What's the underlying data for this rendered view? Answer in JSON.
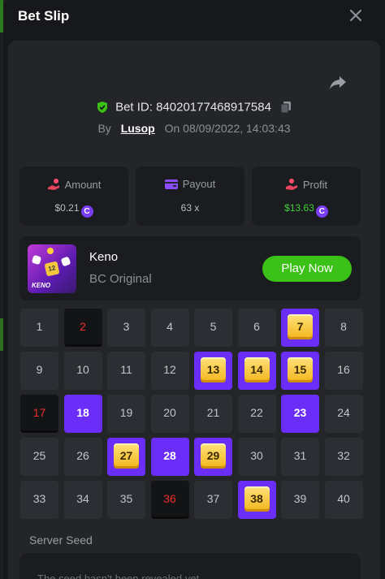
{
  "header": {
    "title": "Bet Slip"
  },
  "bet": {
    "id_label": "Bet ID: 84020177468917584",
    "by_label": "By",
    "user": "Lusop",
    "on_label": "On",
    "datetime": "08/09/2022, 14:03:43"
  },
  "stats": {
    "amount": {
      "label": "Amount",
      "value": "$0.21"
    },
    "payout": {
      "label": "Payout",
      "value": "63 x"
    },
    "profit": {
      "label": "Profit",
      "value": "$13.63"
    }
  },
  "coin_glyph": "C",
  "game": {
    "name": "Keno",
    "subtitle": "BC Original",
    "play_label": "Play Now",
    "thumb_die_1": "12",
    "thumb_text": "KENO"
  },
  "grid": {
    "cells": [
      {
        "n": "1",
        "s": "normal"
      },
      {
        "n": "2",
        "s": "miss"
      },
      {
        "n": "3",
        "s": "normal"
      },
      {
        "n": "4",
        "s": "normal"
      },
      {
        "n": "5",
        "s": "normal"
      },
      {
        "n": "6",
        "s": "normal"
      },
      {
        "n": "7",
        "s": "hit"
      },
      {
        "n": "8",
        "s": "normal"
      },
      {
        "n": "9",
        "s": "normal"
      },
      {
        "n": "10",
        "s": "normal"
      },
      {
        "n": "11",
        "s": "normal"
      },
      {
        "n": "12",
        "s": "normal"
      },
      {
        "n": "13",
        "s": "hit"
      },
      {
        "n": "14",
        "s": "hit"
      },
      {
        "n": "15",
        "s": "hit"
      },
      {
        "n": "16",
        "s": "normal"
      },
      {
        "n": "17",
        "s": "miss"
      },
      {
        "n": "18",
        "s": "selected"
      },
      {
        "n": "19",
        "s": "normal"
      },
      {
        "n": "20",
        "s": "normal"
      },
      {
        "n": "21",
        "s": "normal"
      },
      {
        "n": "22",
        "s": "normal"
      },
      {
        "n": "23",
        "s": "selected"
      },
      {
        "n": "24",
        "s": "normal"
      },
      {
        "n": "25",
        "s": "normal"
      },
      {
        "n": "26",
        "s": "normal"
      },
      {
        "n": "27",
        "s": "hit"
      },
      {
        "n": "28",
        "s": "selected"
      },
      {
        "n": "29",
        "s": "hit"
      },
      {
        "n": "30",
        "s": "normal"
      },
      {
        "n": "31",
        "s": "normal"
      },
      {
        "n": "32",
        "s": "normal"
      },
      {
        "n": "33",
        "s": "normal"
      },
      {
        "n": "34",
        "s": "normal"
      },
      {
        "n": "35",
        "s": "normal"
      },
      {
        "n": "36",
        "s": "miss"
      },
      {
        "n": "37",
        "s": "normal"
      },
      {
        "n": "38",
        "s": "hit"
      },
      {
        "n": "39",
        "s": "normal"
      },
      {
        "n": "40",
        "s": "normal"
      }
    ]
  },
  "seed": {
    "label": "Server Seed",
    "text": "The seed hasn't been revealed yet"
  },
  "colors": {
    "accent_purple": "#6b2ef8",
    "play_green": "#3bc117",
    "profit_green": "#3dd13a",
    "miss_red": "#ee2c2c",
    "gem_gold": "#f2b51a"
  },
  "icons": {
    "close": "close-icon",
    "share": "share-icon",
    "verified": "shield-check-icon",
    "copy": "copy-icon",
    "amount": "hand-coins-icon",
    "payout": "card-icon",
    "profit": "profit-hand-icon"
  }
}
